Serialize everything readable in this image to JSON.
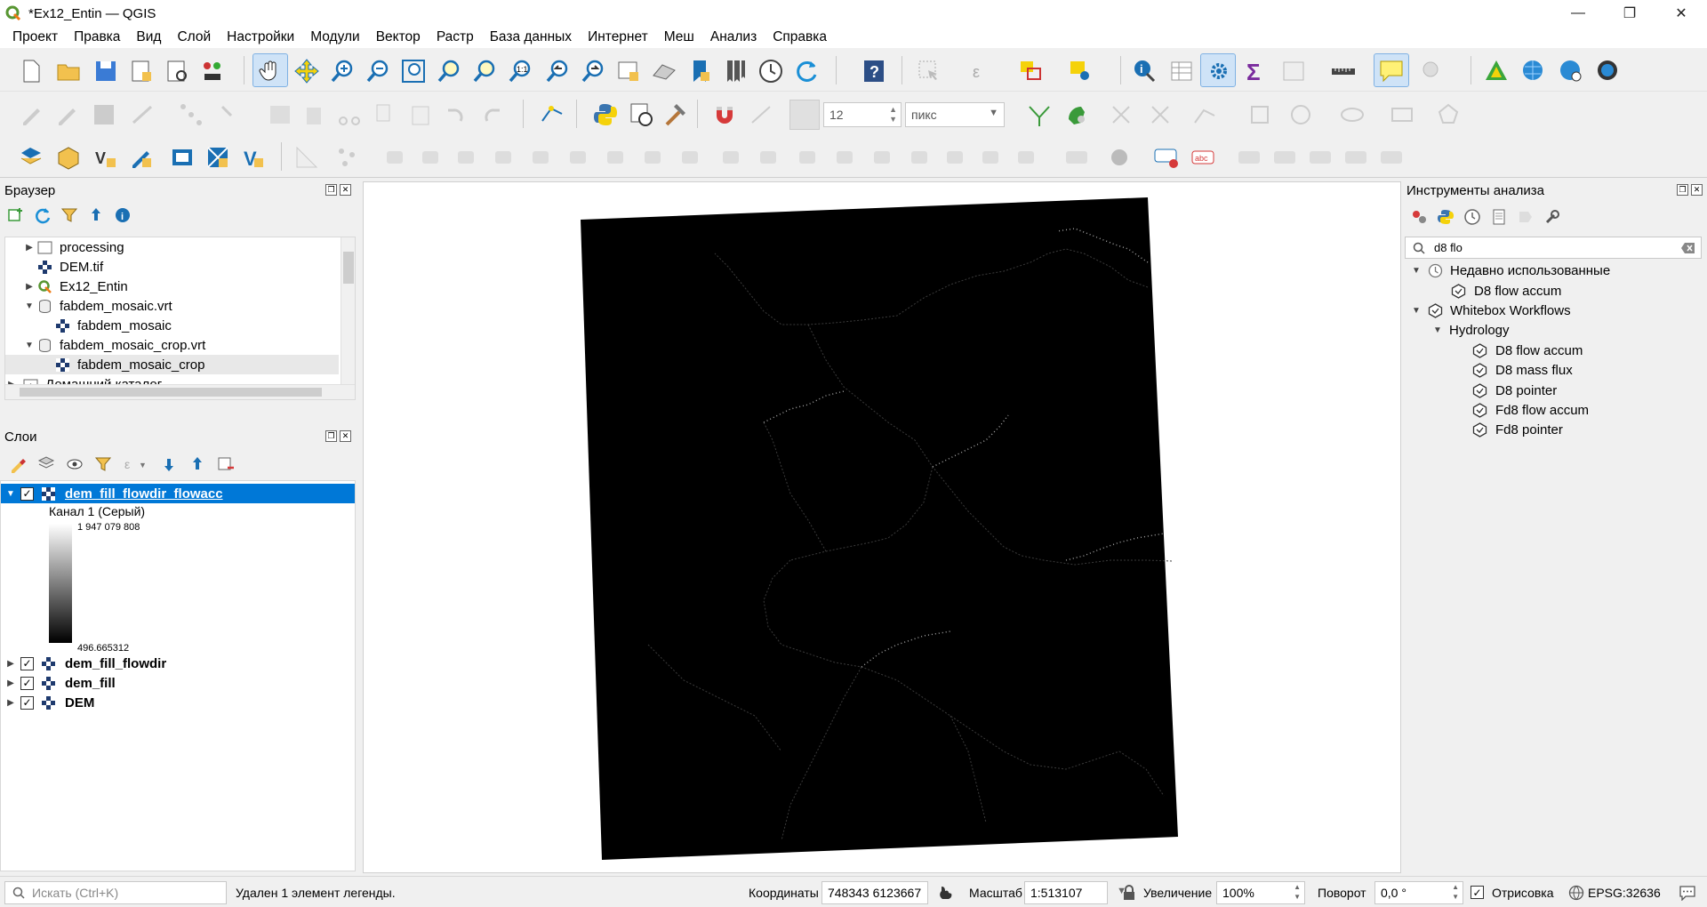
{
  "window": {
    "title": "*Ex12_Entin — QGIS",
    "controls": {
      "minimize": "—",
      "maximize": "❐",
      "close": "✕"
    }
  },
  "menu": [
    "Проект",
    "Правка",
    "Вид",
    "Слой",
    "Настройки",
    "Модули",
    "Вектор",
    "Растр",
    "База данных",
    "Интернет",
    "Меш",
    "Анализ",
    "Справка"
  ],
  "toolbar": {
    "snap_tolerance_value": "12",
    "snap_units": "пикс"
  },
  "browser_panel": {
    "title": "Браузер",
    "items": [
      {
        "label": "processing",
        "type": "folder",
        "expander": "▶"
      },
      {
        "label": "DEM.tif",
        "type": "raster",
        "expander": ""
      },
      {
        "label": "Ex12_Entin",
        "type": "qgis-project",
        "expander": "▶"
      },
      {
        "label": "fabdem_mosaic.vrt",
        "type": "vrt",
        "expander": "▼"
      },
      {
        "label": "fabdem_mosaic",
        "type": "raster",
        "expander": ""
      },
      {
        "label": "fabdem_mosaic_crop.vrt",
        "type": "vrt",
        "expander": "▼"
      },
      {
        "label": "fabdem_mosaic_crop",
        "type": "raster",
        "expander": ""
      },
      {
        "label": "Домашний каталог",
        "type": "home",
        "expander": "▶"
      }
    ]
  },
  "layers_panel": {
    "title": "Слои",
    "layers": [
      {
        "name": "dem_fill_flowdir_flowacc",
        "checked": "✓",
        "expander": "▼"
      },
      {
        "name": "dem_fill_flowdir",
        "checked": "✓",
        "expander": "▶"
      },
      {
        "name": "dem_fill",
        "checked": "✓",
        "expander": "▶"
      },
      {
        "name": "DEM",
        "checked": "✓",
        "expander": "▶"
      }
    ],
    "legend": {
      "band": "Канал 1 (Серый)",
      "max": "1 947 079 808",
      "min": "496.665312"
    }
  },
  "processing_panel": {
    "title": "Инструменты анализа",
    "search_value": "d8 flo",
    "recent_group": "Недавно использованные",
    "recent_items": [
      "D8 flow accum"
    ],
    "provider": "Whitebox Workflows",
    "subgroup": "Hydrology",
    "tools": [
      "D8 flow accum",
      "D8 mass flux",
      "D8 pointer",
      "Fd8 flow accum",
      "Fd8 pointer"
    ]
  },
  "statusbar": {
    "search_placeholder": "Искать (Ctrl+K)",
    "message": "Удален 1 элемент легенды.",
    "coords_label": "Координаты",
    "coords_value": "748343  6123667",
    "scale_label": "Масштаб",
    "scale_value": "1:513107",
    "magnifier_label": "Увеличение",
    "magnifier_value": "100%",
    "rotation_label": "Поворот",
    "rotation_value": "0,0 °",
    "render_label": "Отрисовка",
    "crs": "EPSG:32636"
  },
  "colors": {
    "accent": "#0078d7",
    "raster": "#000000"
  }
}
